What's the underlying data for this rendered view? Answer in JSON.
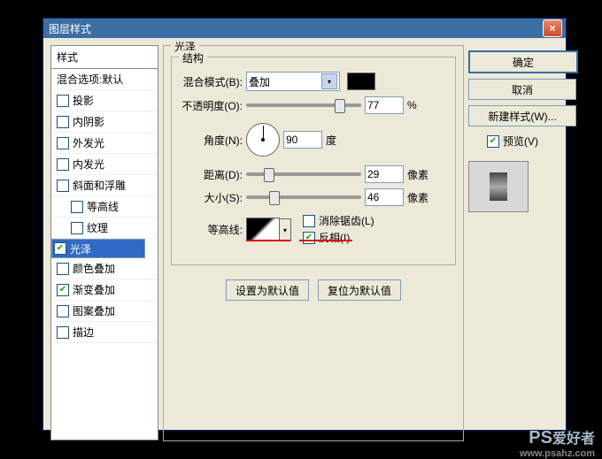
{
  "dialog": {
    "title": "图层样式"
  },
  "styles": {
    "header": "样式",
    "blend_default": "混合选项:默认",
    "items": [
      {
        "key": "drop_shadow",
        "label": "投影",
        "checked": false
      },
      {
        "key": "inner_shadow",
        "label": "内阴影",
        "checked": false
      },
      {
        "key": "outer_glow",
        "label": "外发光",
        "checked": false
      },
      {
        "key": "inner_glow",
        "label": "内发光",
        "checked": false
      },
      {
        "key": "bevel",
        "label": "斜面和浮雕",
        "checked": false
      },
      {
        "key": "contour",
        "label": "等高线",
        "checked": false,
        "sub": true
      },
      {
        "key": "texture",
        "label": "纹理",
        "checked": false,
        "sub": true
      },
      {
        "key": "satin",
        "label": "光泽",
        "checked": true,
        "selected": true
      },
      {
        "key": "color_overlay",
        "label": "颜色叠加",
        "checked": false
      },
      {
        "key": "gradient_overlay",
        "label": "渐变叠加",
        "checked": true
      },
      {
        "key": "pattern_overlay",
        "label": "图案叠加",
        "checked": false
      },
      {
        "key": "stroke",
        "label": "描边",
        "checked": false
      }
    ]
  },
  "satin": {
    "panel_title": "光泽",
    "struct_title": "结构",
    "blend_mode_label": "混合模式(B):",
    "blend_mode_value": "叠加",
    "opacity_label": "不透明度(O):",
    "opacity_value": "77",
    "opacity_unit": "%",
    "angle_label": "角度(N):",
    "angle_value": "90",
    "angle_unit": "度",
    "distance_label": "距离(D):",
    "distance_value": "29",
    "distance_unit": "像素",
    "size_label": "大小(S):",
    "size_value": "46",
    "size_unit": "像素",
    "contour_label": "等高线:",
    "antialias_label": "消除锯齿(L)",
    "antialias_checked": false,
    "invert_label": "反相(I)",
    "invert_checked": true,
    "make_default": "设置为默认值",
    "reset_default": "复位为默认值"
  },
  "buttons": {
    "ok": "确定",
    "cancel": "取消",
    "new_style": "新建样式(W)...",
    "preview": "预览(V)"
  },
  "watermark": {
    "brand": "PS",
    "text": "爱好者",
    "url": "www.psahz.com"
  }
}
